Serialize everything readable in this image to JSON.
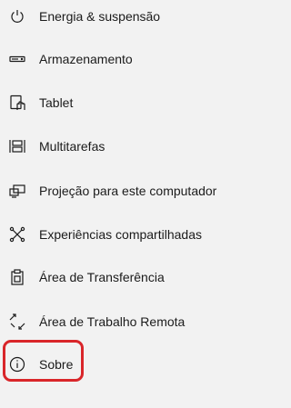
{
  "nav": {
    "items": [
      {
        "label": "Energia & suspensão",
        "icon": "power-icon"
      },
      {
        "label": "Armazenamento",
        "icon": "storage-icon"
      },
      {
        "label": "Tablet",
        "icon": "tablet-icon"
      },
      {
        "label": "Multitarefas",
        "icon": "multitasking-icon"
      },
      {
        "label": "Projeção para este computador",
        "icon": "projection-icon"
      },
      {
        "label": "Experiências compartilhadas",
        "icon": "shared-experiences-icon"
      },
      {
        "label": "Área de Transferência",
        "icon": "clipboard-icon"
      },
      {
        "label": "Área de Trabalho Remota",
        "icon": "remote-desktop-icon"
      },
      {
        "label": "Sobre",
        "icon": "info-icon"
      }
    ]
  },
  "annotation": {
    "highlight_color": "#d9262a",
    "highlighted_item": "Sobre"
  }
}
